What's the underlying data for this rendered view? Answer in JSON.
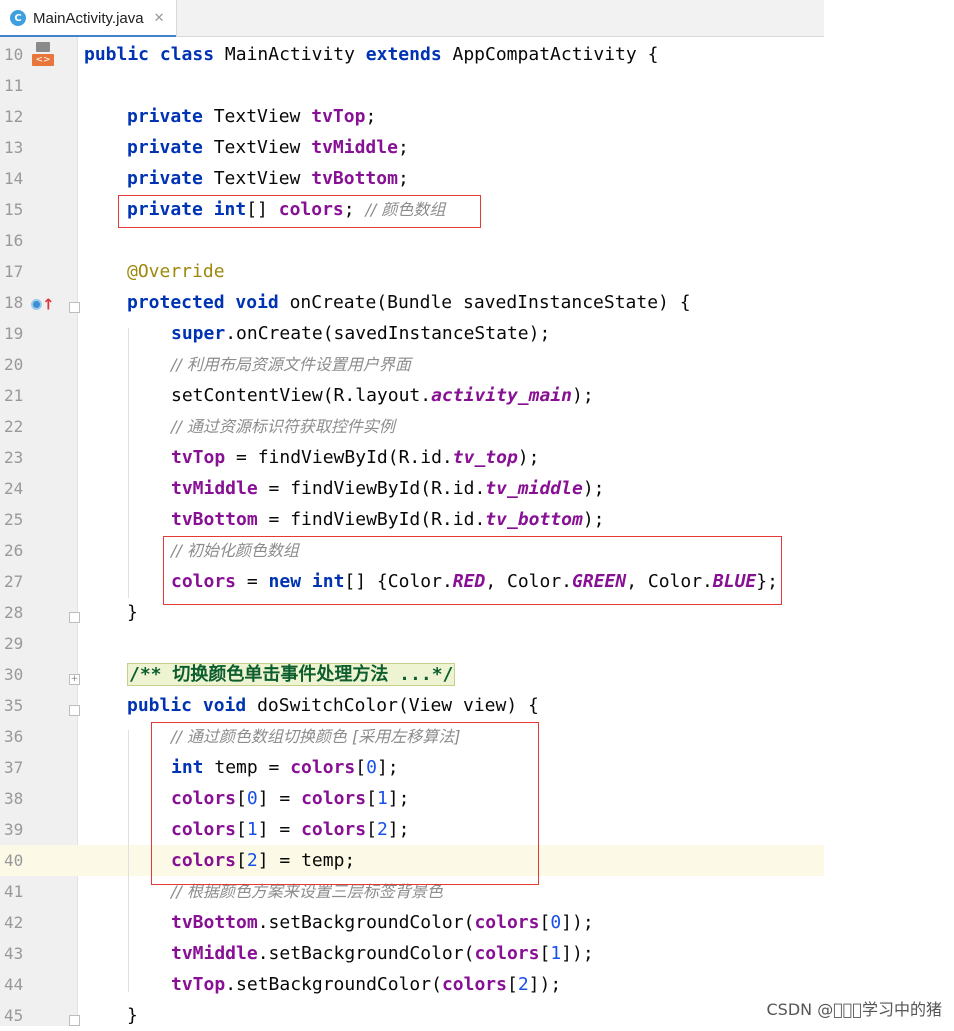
{
  "tab": {
    "icon_letter": "C",
    "file_name": "MainActivity.java",
    "close": "✕"
  },
  "lines": [
    {
      "n": "10"
    },
    {
      "n": "11"
    },
    {
      "n": "12"
    },
    {
      "n": "13"
    },
    {
      "n": "14"
    },
    {
      "n": "15"
    },
    {
      "n": "16"
    },
    {
      "n": "17"
    },
    {
      "n": "18"
    },
    {
      "n": "19"
    },
    {
      "n": "20"
    },
    {
      "n": "21"
    },
    {
      "n": "22"
    },
    {
      "n": "23"
    },
    {
      "n": "24"
    },
    {
      "n": "25"
    },
    {
      "n": "26"
    },
    {
      "n": "27"
    },
    {
      "n": "28"
    },
    {
      "n": "29"
    },
    {
      "n": "30"
    },
    {
      "n": "35"
    },
    {
      "n": "36"
    },
    {
      "n": "37"
    },
    {
      "n": "38"
    },
    {
      "n": "39"
    },
    {
      "n": "40"
    },
    {
      "n": "41"
    },
    {
      "n": "42"
    },
    {
      "n": "43"
    },
    {
      "n": "44"
    },
    {
      "n": "45"
    }
  ],
  "code": {
    "l10": {
      "public": "public",
      "class": "class",
      "classname": "MainActivity",
      "extends": "extends",
      "superclass": "AppCompatActivity {"
    },
    "l12": {
      "private": "private",
      "type": "TextView",
      "field": "tvTop",
      ";": ";"
    },
    "l13": {
      "private": "private",
      "type": "TextView",
      "field": "tvMiddle",
      ";": ";"
    },
    "l14": {
      "private": "private",
      "type": "TextView",
      "field": "tvBottom",
      ";": ";"
    },
    "l15": {
      "private": "private",
      "int": "int",
      "arr": "[]",
      "field": "colors",
      "semi": ";",
      "comment": "// 颜色数组"
    },
    "l17": {
      "annotation": "@Override"
    },
    "l18": {
      "protected": "protected",
      "void": "void",
      "rest": "onCreate(Bundle savedInstanceState) {"
    },
    "l19": {
      "super": "super",
      "rest": ".onCreate(savedInstanceState);"
    },
    "l20": {
      "comment": "// 利用布局资源文件设置用户界面"
    },
    "l21": {
      "pre": "setContentView(R.layout.",
      "const": "activity_main",
      "post": ");"
    },
    "l22": {
      "comment": "// 通过资源标识符获取控件实例"
    },
    "l23": {
      "field": "tvTop",
      "pre": " = findViewById(R.id.",
      "const": "tv_top",
      "post": ");"
    },
    "l24": {
      "field": "tvMiddle",
      "pre": " = findViewById(R.id.",
      "const": "tv_middle",
      "post": ");"
    },
    "l25": {
      "field": "tvBottom",
      "pre": " = findViewById(R.id.",
      "const": "tv_bottom",
      "post": ");"
    },
    "l26": {
      "comment": "// 初始化颜色数组"
    },
    "l27": {
      "field": "colors",
      "eq": " = ",
      "new": "new",
      "int": "int",
      "mid": "[] {Color.",
      "red": "RED",
      "c1": ", Color.",
      "green": "GREEN",
      "c2": ", Color.",
      "blue": "BLUE",
      "end": "};"
    },
    "l28": {
      "brace": "}"
    },
    "l30": {
      "doc": "/** 切换颜色单击事件处理方法 ...*/"
    },
    "l35": {
      "public": "public",
      "void": "void",
      "rest": "doSwitchColor(View view) {"
    },
    "l36": {
      "comment": "// 通过颜色数组切换颜色 [采用左移算法]"
    },
    "l37": {
      "int": "int",
      "mid": " temp = ",
      "field": "colors",
      "o": "[",
      "idx": "0",
      "c": "];"
    },
    "l38": {
      "f1": "colors",
      "o1": "[",
      "i1": "0",
      "c1": "] = ",
      "f2": "colors",
      "o2": "[",
      "i2": "1",
      "c2": "];"
    },
    "l39": {
      "f1": "colors",
      "o1": "[",
      "i1": "1",
      "c1": "] = ",
      "f2": "colors",
      "o2": "[",
      "i2": "2",
      "c2": "];"
    },
    "l40": {
      "f1": "colors",
      "o1": "[",
      "i1": "2",
      "c1": "] = temp;"
    },
    "l41": {
      "comment": "// 根据颜色方案来设置三层标签背景色"
    },
    "l42": {
      "field": "tvBottom",
      "mid": ".setBackgroundColor(",
      "f2": "colors",
      "o": "[",
      "idx": "0",
      "c": "]);"
    },
    "l43": {
      "field": "tvMiddle",
      "mid": ".setBackgroundColor(",
      "f2": "colors",
      "o": "[",
      "idx": "1",
      "c": "]);"
    },
    "l44": {
      "field": "tvTop",
      "mid": ".setBackgroundColor(",
      "f2": "colors",
      "o": "[",
      "idx": "2",
      "c": "]);"
    },
    "l45": {
      "brace": "}"
    }
  },
  "watermark": "CSDN @\u0000\u0000\u0000学习中的猪",
  "colors": {
    "keyword": "#0033b3",
    "field": "#871094",
    "comment": "#8c8c8c",
    "annotation": "#9e880d",
    "number": "#1750eb",
    "highlight_box": "#e53935"
  }
}
